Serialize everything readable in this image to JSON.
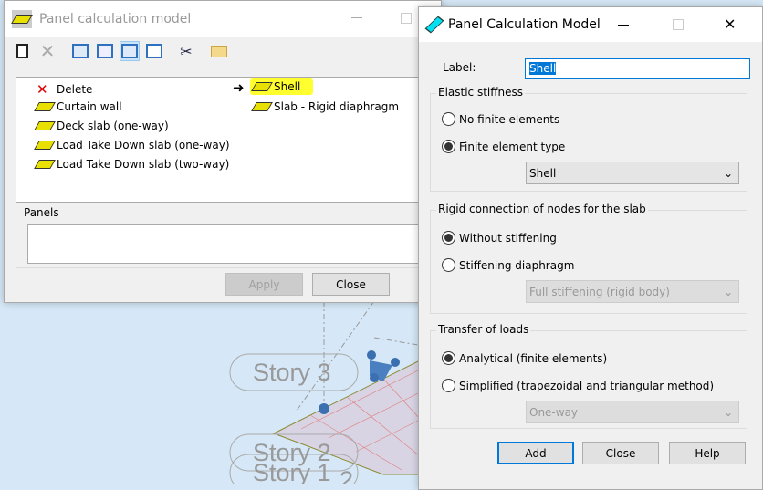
{
  "viewport": {
    "story_labels": [
      "Story 3",
      "Story 2",
      "Story 1",
      "2"
    ]
  },
  "left_dialog": {
    "title": "Panel calculation model",
    "toolbar": [
      "new-icon",
      "delete-icon",
      "view-large-icons",
      "view-small-icons",
      "view-list-icon",
      "view-details-icon",
      "cut-icon",
      "open-folder-icon"
    ],
    "items_left": [
      "Delete",
      "Curtain wall",
      "Deck slab (one-way)",
      "Load Take Down slab (one-way)",
      "Load Take Down slab (two-way)"
    ],
    "items_right": [
      "Shell",
      "Slab - Rigid diaphragm"
    ],
    "selected": "Shell",
    "panels_label": "Panels",
    "panels_value": "",
    "apply": "Apply",
    "close": "Close"
  },
  "right_dialog": {
    "title": "Panel Calculation Model",
    "label_caption": "Label:",
    "label_value": "Shell",
    "elastic": {
      "title": "Elastic stiffness",
      "opt1": "No finite elements",
      "opt2": "Finite element type",
      "select": "Shell",
      "selected": 2
    },
    "rigid": {
      "title": "Rigid connection of nodes for the slab",
      "opt1": "Without stiffening",
      "opt2": "Stiffening diaphragm",
      "select": "Full stiffening (rigid body)",
      "selected": 1
    },
    "transfer": {
      "title": "Transfer of loads",
      "opt1": "Analytical (finite elements)",
      "opt2": "Simplified (trapezoidal and triangular method)",
      "select": "One-way",
      "selected": 1
    },
    "add": "Add",
    "close": "Close",
    "help": "Help"
  }
}
